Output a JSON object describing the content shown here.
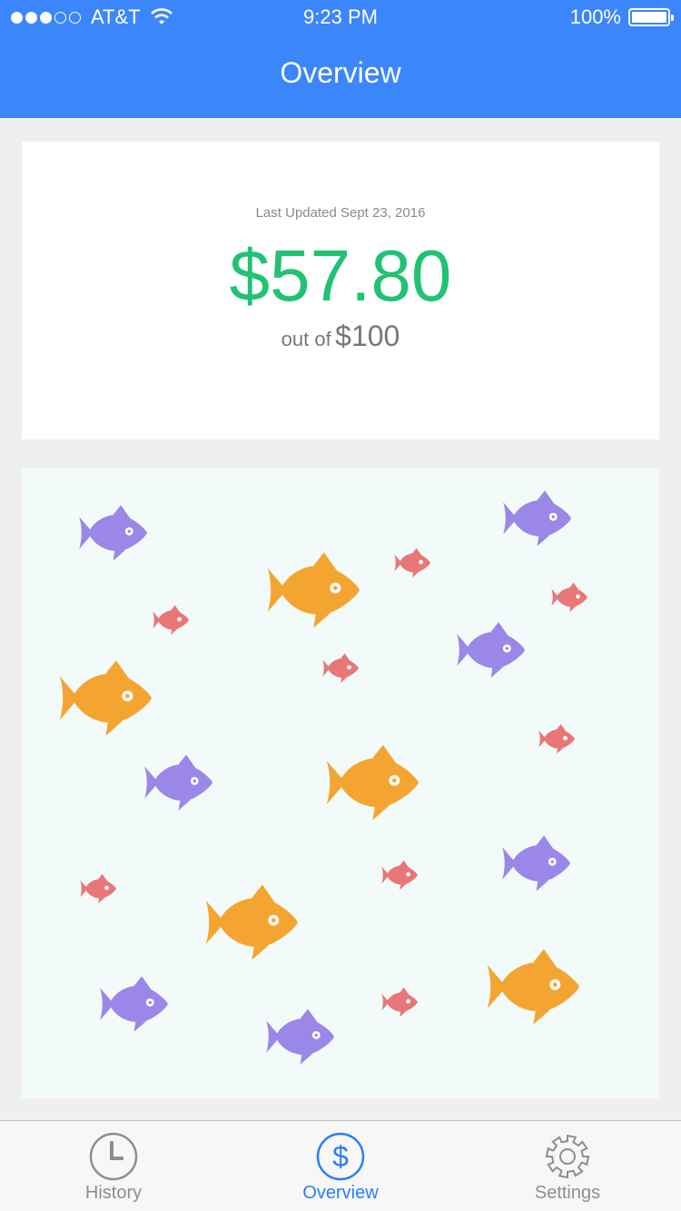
{
  "status_bar": {
    "carrier": "AT&T",
    "time": "9:23 PM",
    "battery": "100%",
    "signal_bars_filled": 3,
    "signal_bars_total": 5
  },
  "header": {
    "title": "Overview",
    "color": "#3b86fb"
  },
  "summary": {
    "last_updated": "Last Updated Sept 23, 2016",
    "amount": "$57.80",
    "out_of_label": "out of",
    "limit": "$100",
    "amount_color": "#21c274"
  },
  "fish_panel": {
    "fish_colors": {
      "purple": "#9b87e8",
      "orange": "#f4a531",
      "red": "#e87778"
    }
  },
  "tab_bar": {
    "tabs": [
      {
        "label": "History",
        "icon": "clock-icon",
        "active": false
      },
      {
        "label": "Overview",
        "icon": "dollar-icon",
        "active": true
      },
      {
        "label": "Settings",
        "icon": "gear-icon",
        "active": false
      }
    ],
    "active_color": "#2a7ef5",
    "inactive_color": "#8e8e8e"
  }
}
